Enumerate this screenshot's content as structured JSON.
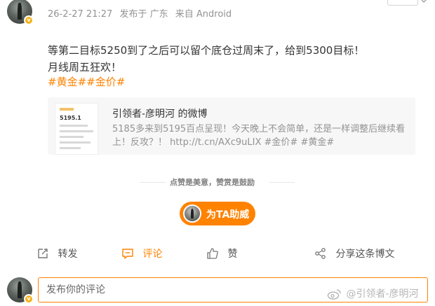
{
  "post": {
    "meta": {
      "timestamp": "26-2-27 21:27",
      "location": "发布于 广东",
      "source": "来自 Android"
    },
    "follow_label": "",
    "content_line1": "等第二目标5250到了之后可以留个底仓过周末了，给到5300目标！",
    "content_line2": "月线周五狂欢！",
    "tags": "#黄金##金价#"
  },
  "card": {
    "title": "引领者-彦明河 的微博",
    "thumb_value": "5195.1",
    "body": "5185多来到5195百点呈现！今天晚上不会简单，还是一样调整后继续看上！反攻？！ http://t.cn/AXc9uLIX #金价# #黄金#"
  },
  "divider": {
    "text": "点赞是美意，赞赏是鼓励"
  },
  "reward": {
    "label": "为TA助威"
  },
  "actions": {
    "repost": "转发",
    "comment": "评论",
    "like": "赞",
    "share": "分享这条博文"
  },
  "comment_input": {
    "placeholder": "发布你的评论"
  },
  "watermark": {
    "text": "@引领者-彦明河"
  },
  "colors": {
    "accent": "#ff8200",
    "meta_gray": "#939393",
    "card_bg": "#f7f7f7",
    "badge": "#f6b21b"
  }
}
